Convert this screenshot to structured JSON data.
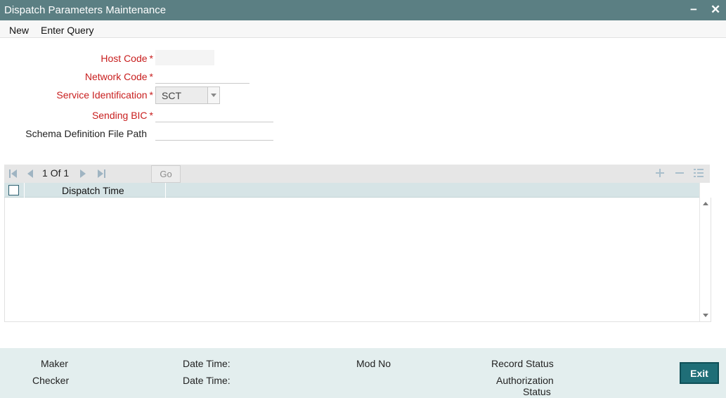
{
  "window": {
    "title": "Dispatch Parameters Maintenance",
    "minimize_glyph": "−",
    "close_glyph": "✕"
  },
  "menu": {
    "new_label": "New",
    "enter_query_label": "Enter Query"
  },
  "form": {
    "host_code": {
      "label": "Host Code",
      "required_mark": "*",
      "value": ""
    },
    "network_code": {
      "label": "Network Code",
      "required_mark": "*",
      "value": ""
    },
    "service_identification": {
      "label": "Service Identification",
      "required_mark": "*",
      "selected": "SCT"
    },
    "sending_bic": {
      "label": "Sending BIC",
      "required_mark": "*",
      "value": ""
    },
    "schema_definition_file_path": {
      "label": "Schema Definition File Path",
      "value": ""
    }
  },
  "grid": {
    "pager": {
      "current": "1",
      "of_text": "Of",
      "total": "1"
    },
    "go_label": "Go",
    "columns": [
      "Dispatch Time"
    ],
    "rows": [],
    "icons": {
      "first": "first-page-icon",
      "prev": "previous-page-icon",
      "next": "next-page-icon",
      "last": "last-page-icon",
      "add": "add-row-icon",
      "delete": "delete-row-icon",
      "view": "single-view-icon"
    }
  },
  "footer": {
    "maker_label": "Maker",
    "checker_label": "Checker",
    "date_time_label_1": "Date Time:",
    "date_time_label_2": "Date Time:",
    "mod_no_label": "Mod No",
    "record_status_label": "Record Status",
    "authorization_status_line1": "Authorization",
    "authorization_status_line2": "Status",
    "exit_label": "Exit"
  },
  "colors": {
    "titlebar": "#5b7f83",
    "required_label": "#c81e1e",
    "grid_header": "#d6e4e6",
    "footer": "#e3eeee",
    "exit_button": "#1f6e77"
  }
}
